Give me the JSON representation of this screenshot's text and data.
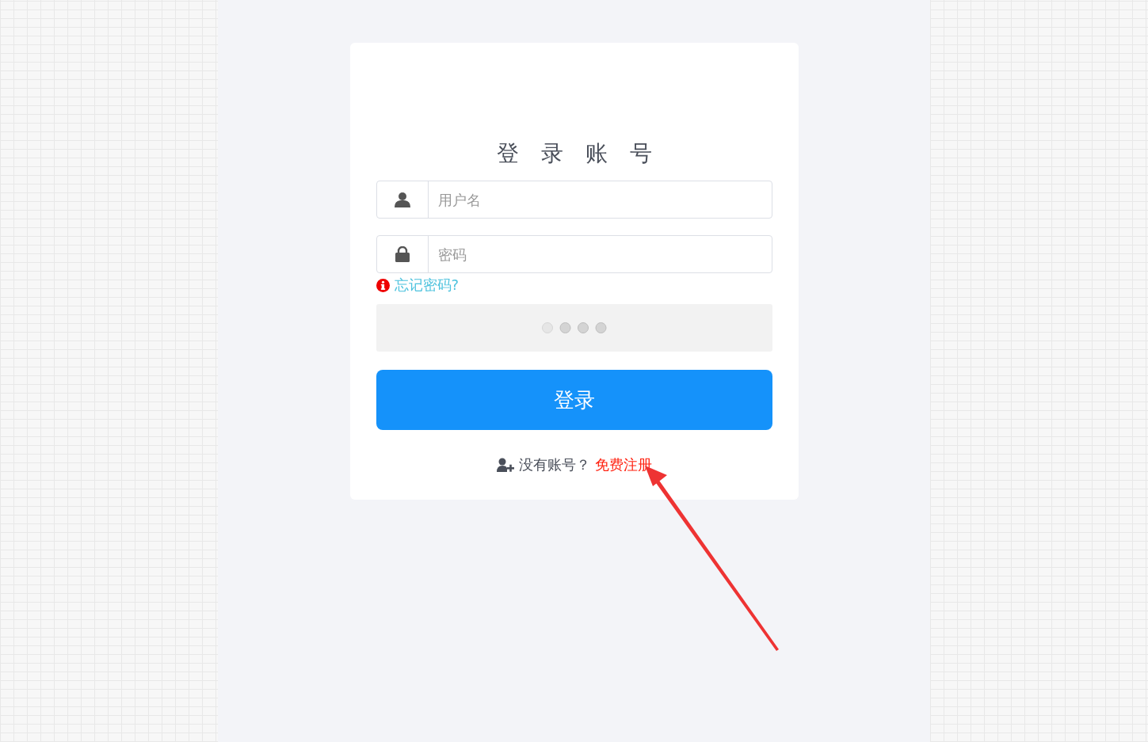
{
  "title": "登录账号",
  "username": {
    "placeholder": "用户名"
  },
  "password": {
    "placeholder": "密码"
  },
  "forgot_link": "忘记密码?",
  "login_button": "登录",
  "register": {
    "prompt": "没有账号？",
    "link": "免费注册"
  }
}
